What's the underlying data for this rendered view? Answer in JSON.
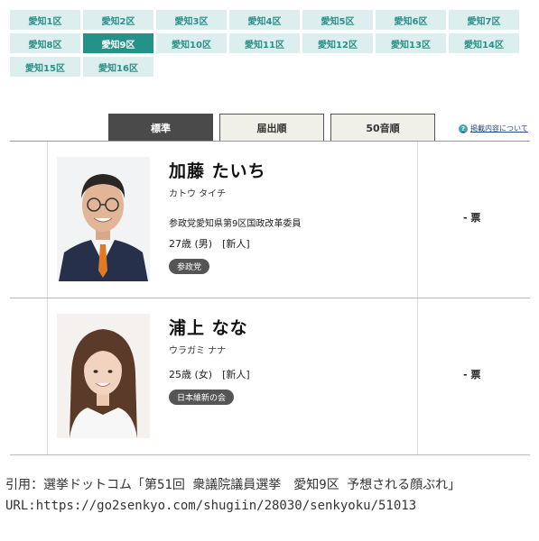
{
  "districts": [
    {
      "label": "愛知1区",
      "active": false
    },
    {
      "label": "愛知2区",
      "active": false
    },
    {
      "label": "愛知3区",
      "active": false
    },
    {
      "label": "愛知4区",
      "active": false
    },
    {
      "label": "愛知5区",
      "active": false
    },
    {
      "label": "愛知6区",
      "active": false
    },
    {
      "label": "愛知7区",
      "active": false
    },
    {
      "label": "愛知8区",
      "active": false
    },
    {
      "label": "愛知9区",
      "active": true
    },
    {
      "label": "愛知10区",
      "active": false
    },
    {
      "label": "愛知11区",
      "active": false
    },
    {
      "label": "愛知12区",
      "active": false
    },
    {
      "label": "愛知13区",
      "active": false
    },
    {
      "label": "愛知14区",
      "active": false
    },
    {
      "label": "愛知15区",
      "active": false
    },
    {
      "label": "愛知16区",
      "active": false
    }
  ],
  "sort_tabs": [
    {
      "label": "標準",
      "active": true
    },
    {
      "label": "届出順",
      "active": false
    },
    {
      "label": "50音順",
      "active": false
    }
  ],
  "help": {
    "icon": "?",
    "label": "掲載内容について"
  },
  "candidates": [
    {
      "name": "加藤 たいち",
      "kana": "カトウ タイチ",
      "position": "参政党愛知県第9区国政改革委員",
      "age_line": "27歳 (男)　[新人]",
      "party": "参政党",
      "votes": "- 票"
    },
    {
      "name": "浦上 なな",
      "kana": "ウラガミ ナナ",
      "position": "",
      "age_line": "25歳 (女)　[新人]",
      "party": "日本維新の会",
      "votes": "- 票"
    }
  ],
  "citation": {
    "line1": "引用：選挙ドットコム「第51回 衆議院議員選挙　愛知9区 予想される顔ぶれ」",
    "line2": "URL:https://go2senkyo.com/shugiin/28030/senkyoku/51013"
  },
  "colors": {
    "district_bg": "#dcefee",
    "district_text": "#2a8f88",
    "district_active": "#259289",
    "sort_active": "#4a4a4a",
    "badge": "#555555"
  }
}
